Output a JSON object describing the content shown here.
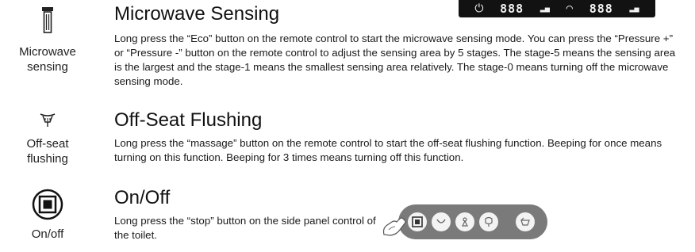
{
  "sections": [
    {
      "icon": "microwave-sensor-icon",
      "label": "Microwave\nsensing",
      "title": "Microwave Sensing",
      "text": "Long press the “Eco” button on the remote control to start the microwave sensing mode. You can press the “Pressure +” or “Pressure -” button on the remote control to adjust the sensing area by 5 stages. The stage-5 means the sensing area is the largest and the stage-1 means the smallest sensing area relatively. The stage-0 means turning off the microwave sensing mode."
    },
    {
      "icon": "off-seat-flushing-icon",
      "label": "Off-seat\nflushing",
      "title": "Off-Seat Flushing",
      "text": "Long press the “massage” button on the remote control to start the off-seat flushing function. Beeping for once means turning on this function. Beeping for 3 times means turning off this function."
    },
    {
      "icon": "stop-button-icon",
      "label": "On/off",
      "title": "On/Off",
      "text": "Long press the “stop” button on the side panel control of the toilet."
    }
  ],
  "display": {
    "left_reading": "888",
    "right_reading": "888"
  },
  "panel": {
    "buttons": [
      "stop-button-icon",
      "rear-wash-icon",
      "front-wash-icon",
      "dryer-icon",
      "flush-icon"
    ]
  },
  "colors": {
    "text": "#1a1a1a",
    "display_bg": "#121212",
    "panel_bg": "#7a7a7a"
  }
}
